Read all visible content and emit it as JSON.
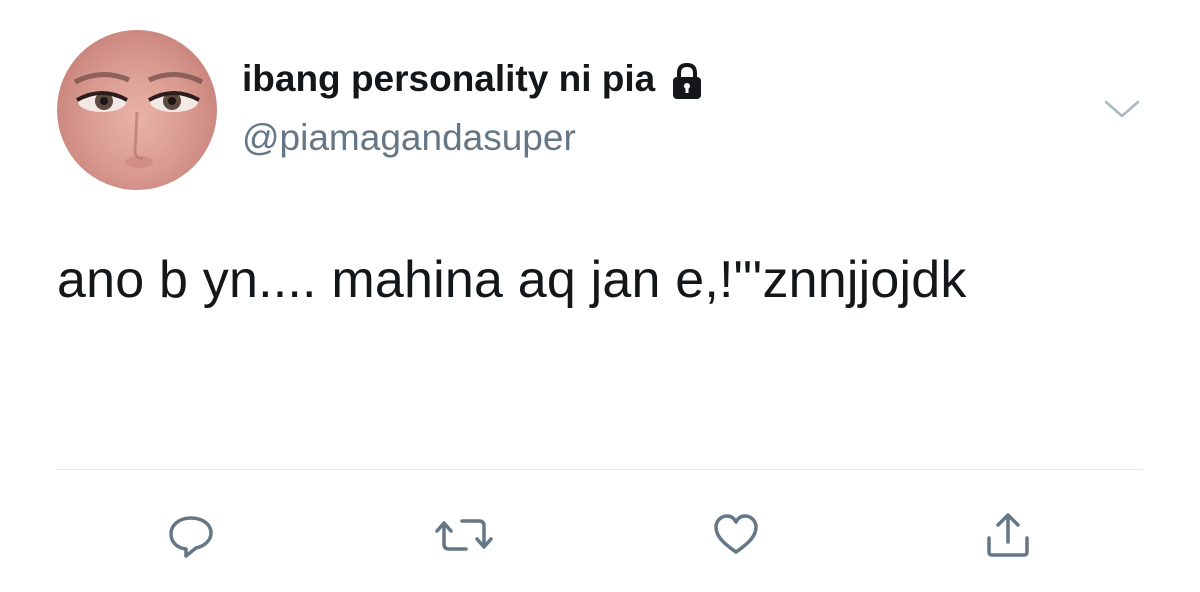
{
  "tweet": {
    "author": {
      "display_name": "ibang personality ni pia",
      "handle": "@piamagandasuper",
      "protected_icon": "lock-icon",
      "avatar_icon": "avatar"
    },
    "text": "ano b yn.... mahina aq jan e,!\"'znnjjojdk",
    "menu_icon": "chevron-down-icon"
  },
  "actions": [
    {
      "name": "reply",
      "icon": "reply-icon"
    },
    {
      "name": "retweet",
      "icon": "retweet-icon"
    },
    {
      "name": "like",
      "icon": "heart-icon"
    },
    {
      "name": "share",
      "icon": "share-icon"
    }
  ],
  "colors": {
    "text_primary": "#14171a",
    "text_secondary": "#657786",
    "icon_gray": "#657786",
    "divider": "#e1e8ed"
  }
}
